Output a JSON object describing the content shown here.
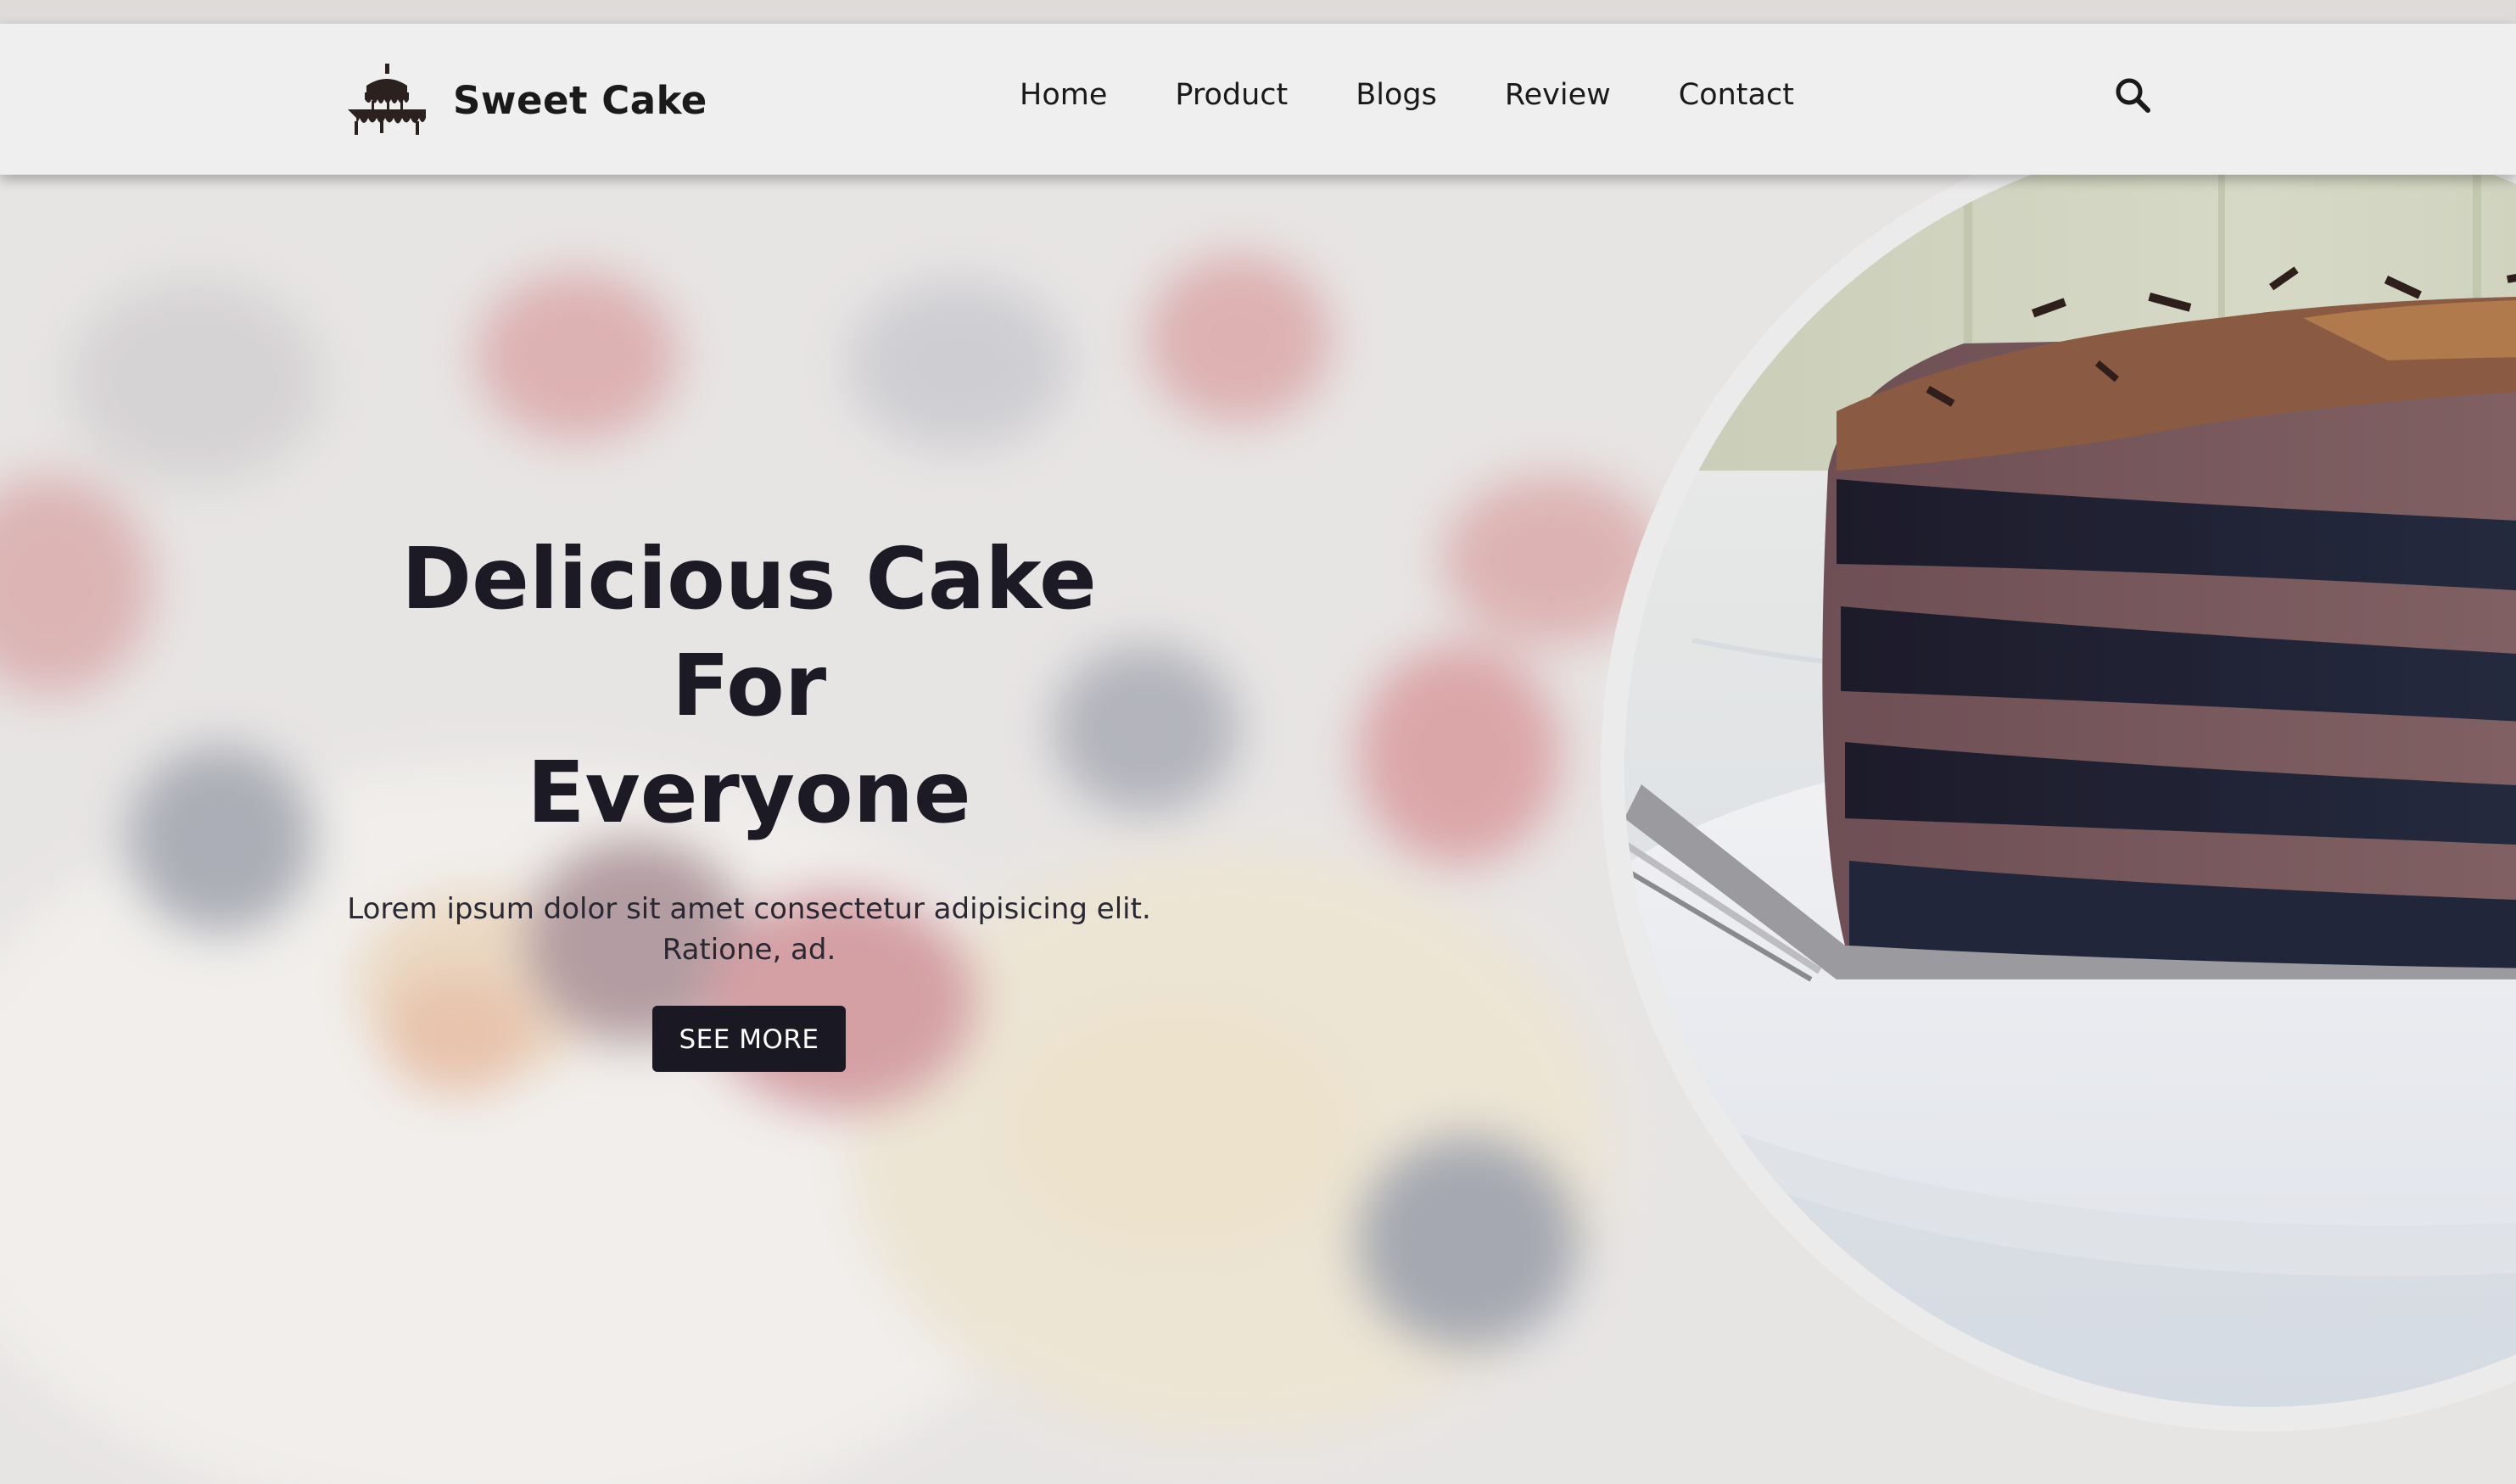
{
  "header": {
    "brand_name": "Sweet Cake",
    "logo_icon": "cake-icon",
    "nav": [
      {
        "label": "Home"
      },
      {
        "label": "Product"
      },
      {
        "label": "Blogs"
      },
      {
        "label": "Review"
      },
      {
        "label": "Contact"
      }
    ],
    "search_icon": "search-icon"
  },
  "hero": {
    "title_line1": "Delicious Cake For",
    "title_line2": "Everyone",
    "text_line1": "Lorem ipsum dolor sit amet consectetur adipisicing elit.",
    "text_line2": "Ratione, ad.",
    "cta_label": "SEE MORE",
    "image": "chocolate-cake-slice-photo"
  },
  "colors": {
    "header_bg": "#efefef",
    "text_dark": "#1c1a25",
    "button_bg": "#1a1822",
    "button_text": "#ffffff",
    "ring": "#ecebeb"
  }
}
